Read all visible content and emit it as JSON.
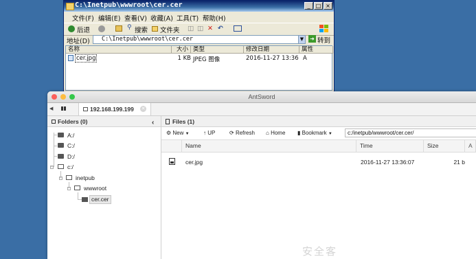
{
  "explorer": {
    "title": "C:\\Inetpub\\wwwroot\\cer.cer",
    "window_buttons": [
      "_",
      "□",
      "×"
    ],
    "menu": [
      "文件(F)",
      "编辑(E)",
      "查看(V)",
      "收藏(A)",
      "工具(T)",
      "帮助(H)"
    ],
    "toolbar": {
      "back": "后退",
      "search": "搜索",
      "folders": "文件夹"
    },
    "address_label": "地址(D)",
    "address_value": "C:\\Inetpub\\wwwroot\\cer.cer",
    "go_label": "转到",
    "columns": [
      "名称",
      "大小",
      "类型",
      "修改日期",
      "属性"
    ],
    "files": [
      {
        "name": "cer.jpg",
        "size": "1 KB",
        "type": "JPEG 图像",
        "modified": "2016-11-27 13:36",
        "attr": "A"
      }
    ]
  },
  "antsword": {
    "title": "AntSword",
    "tab_label": "192.168.199.199",
    "folders_header": "Folders (0)",
    "tree": [
      "A:/",
      "C:/",
      "D:/",
      "c:/",
      "inetpub",
      "wwwroot",
      "cer.cer"
    ],
    "files_header": "Files (1)",
    "toolbar": {
      "new": "New",
      "up": "UP",
      "refresh": "Refresh",
      "home": "Home",
      "bookmark": "Bookmark",
      "path": "c:/inetpub/wwwroot/cer.cer/"
    },
    "columns": [
      "Name",
      "Time",
      "Size"
    ],
    "files": [
      {
        "name": "cer.jpg",
        "time": "2016-11-27 13:36:07",
        "size": "21 b"
      }
    ]
  },
  "watermark": "安全客"
}
